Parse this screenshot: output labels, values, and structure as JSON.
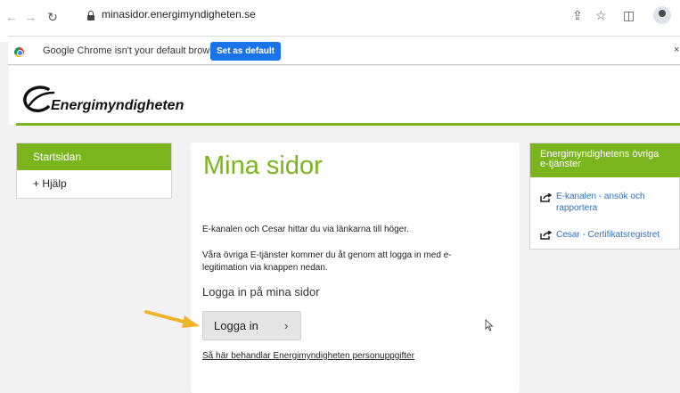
{
  "browser": {
    "url": "minasidor.energimyndigheten.se",
    "infobar": {
      "message": "Google Chrome isn't your default browser",
      "button": "Set as default",
      "close": "×"
    }
  },
  "header": {
    "logo_text": "Energimyndigheten",
    "accent": "#7ab51d"
  },
  "leftnav": {
    "items": [
      {
        "label": "Startsidan",
        "active": true
      },
      {
        "label": "+ Hjälp",
        "active": false
      }
    ]
  },
  "main": {
    "title": "Mina sidor",
    "para1": "E-kanalen och Cesar hittar du via länkarna till höger.",
    "para2": "Våra övriga E-tjänster kommer du åt genom att logga in med e-legitimation via knappen nedan.",
    "subheading": "Logga in på mina sidor",
    "login_button": "Logga in",
    "login_chevron": "›",
    "privacy_link": "Så här behandlar Energimyndigheten personuppgifter"
  },
  "rightbox": {
    "heading": "Energimyndighetens övriga e-tjänster",
    "links": [
      "E-kanalen - ansök och rapportera",
      "Cesar - Certifikatsregistret"
    ],
    "link_color": "#2d71c1"
  }
}
